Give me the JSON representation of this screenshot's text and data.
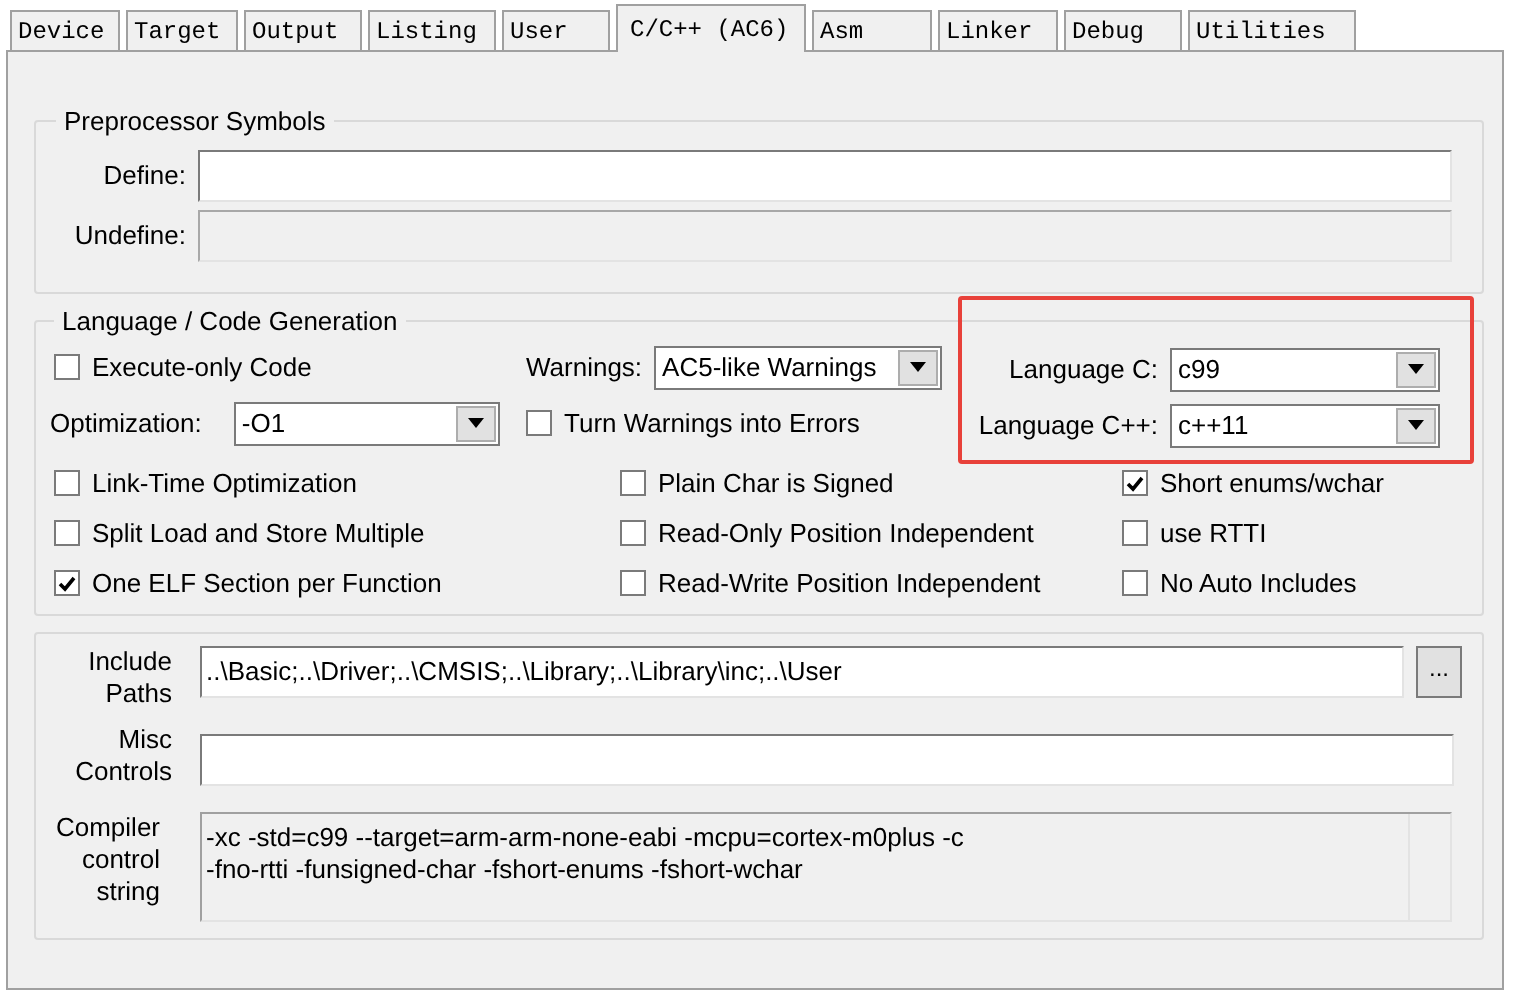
{
  "tabs": [
    {
      "label": "Device",
      "selected": false
    },
    {
      "label": "Target",
      "selected": false
    },
    {
      "label": "Output",
      "selected": false
    },
    {
      "label": "Listing",
      "selected": false
    },
    {
      "label": "User",
      "selected": false
    },
    {
      "label": "C/C++ (AC6)",
      "selected": true
    },
    {
      "label": "Asm",
      "selected": false
    },
    {
      "label": "Linker",
      "selected": false
    },
    {
      "label": "Debug",
      "selected": false
    },
    {
      "label": "Utilities",
      "selected": false
    }
  ],
  "preprocessor": {
    "title": "Preprocessor Symbols",
    "fields": [
      {
        "label": "Define:",
        "disabled": false
      },
      {
        "label": "Undefine:",
        "disabled": true
      }
    ]
  },
  "language": {
    "title": "Language / Code Generation",
    "execute_only": {
      "label": "Execute-only Code",
      "checked": false
    },
    "warnings": {
      "label": "Warnings:",
      "value": "AC5-like Warnings"
    },
    "optimization": {
      "label": "Optimization:",
      "value": "-O1"
    },
    "turn_warnings_into_errors": {
      "label": "Turn Warnings into Errors",
      "checked": false
    },
    "language_c": {
      "label": "Language C:",
      "value": "c99"
    },
    "language_cpp": {
      "label": "Language C++:",
      "value": "c++11"
    },
    "options_columns": [
      [
        {
          "label": "Link-Time Optimization",
          "checked": false
        },
        {
          "label": "Split Load and Store Multiple",
          "checked": false
        },
        {
          "label": "One ELF Section per Function",
          "checked": true
        }
      ],
      [
        {
          "label": "Plain Char is Signed",
          "checked": false
        },
        {
          "label": "Read-Only Position Independent",
          "checked": false
        },
        {
          "label": "Read-Write Position Independent",
          "checked": false
        }
      ],
      [
        {
          "label": "Short enums/wchar",
          "checked": true
        },
        {
          "label": "use RTTI",
          "checked": false
        },
        {
          "label": "No Auto Includes",
          "checked": false
        }
      ]
    ]
  },
  "include_paths": {
    "label": "Include Paths",
    "value": "..\\Basic;..\\Driver;..\\CMSIS;..\\Library;..\\Library\\inc;..\\User",
    "browse": "..."
  },
  "misc_controls": {
    "label": "Misc Controls"
  },
  "compiler_control_string": {
    "label": "Compiler control string",
    "lines": [
      "-xc -std=c99 --target=arm-arm-none-eabi -mcpu=cortex-m0plus -c",
      "-fno-rtti -funsigned-char -fshort-enums -fshort-wchar"
    ]
  }
}
